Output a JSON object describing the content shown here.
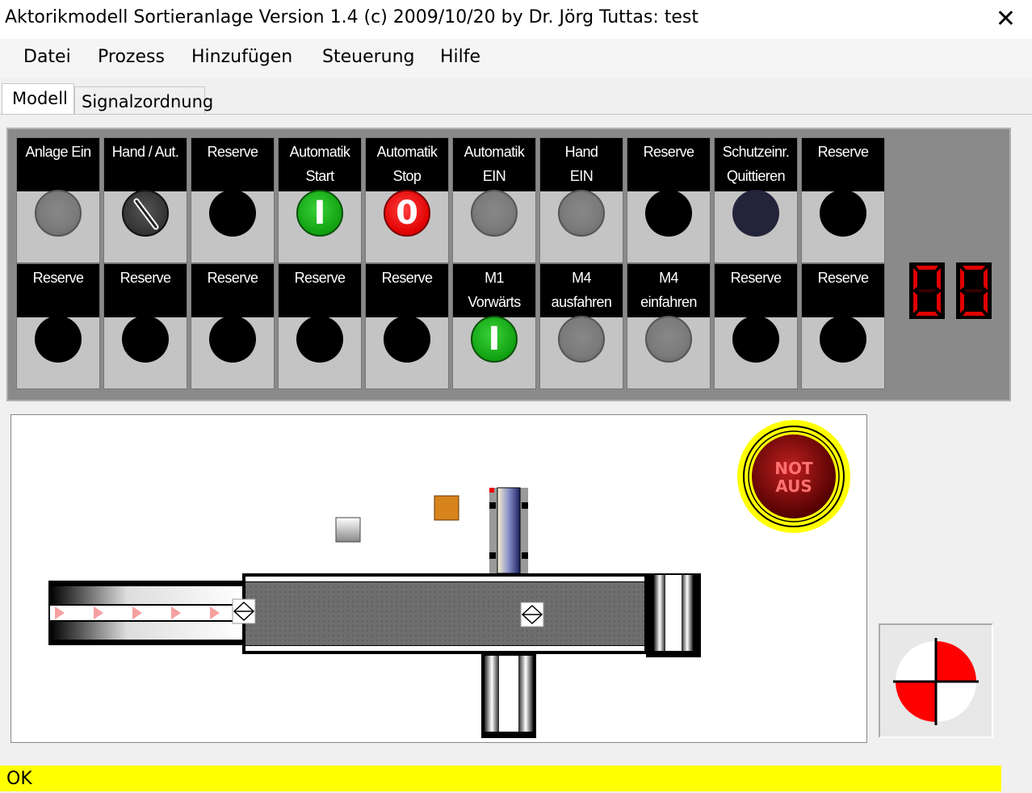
{
  "window": {
    "title": "Aktorikmodell Sortieranlage Version 1.4 (c) 2009/10/20 by Dr. Jörg Tuttas: test",
    "close_glyph": "✕"
  },
  "menu": [
    "Datei",
    "Prozess",
    "Hinzufügen",
    "Steuerung",
    "Hilfe"
  ],
  "tabs": [
    {
      "label": "Modell",
      "active": true
    },
    {
      "label": "Signalzordnung",
      "active": false
    }
  ],
  "panel": {
    "row1": [
      {
        "label": "Anlage Ein",
        "state": "gray",
        "glyph": ""
      },
      {
        "label": "Hand / Aut.",
        "state": "switch",
        "glyph": ""
      },
      {
        "label": "Reserve",
        "state": "black",
        "glyph": ""
      },
      {
        "label": "Automatik\nStart",
        "state": "green",
        "glyph": "I"
      },
      {
        "label": "Automatik\nStop",
        "state": "red",
        "glyph": "0"
      },
      {
        "label": "Automatik\nEIN",
        "state": "gray",
        "glyph": ""
      },
      {
        "label": "Hand\nEIN",
        "state": "gray",
        "glyph": ""
      },
      {
        "label": "Reserve",
        "state": "black",
        "glyph": ""
      },
      {
        "label": "Schutzeinr.\nQuittieren",
        "state": "navy",
        "glyph": ""
      },
      {
        "label": "Reserve",
        "state": "black",
        "glyph": ""
      }
    ],
    "row2": [
      {
        "label": "Reserve",
        "state": "black",
        "glyph": ""
      },
      {
        "label": "Reserve",
        "state": "black",
        "glyph": ""
      },
      {
        "label": "Reserve",
        "state": "black",
        "glyph": ""
      },
      {
        "label": "Reserve",
        "state": "black",
        "glyph": ""
      },
      {
        "label": "Reserve",
        "state": "black",
        "glyph": ""
      },
      {
        "label": "M1\nVorwärts",
        "state": "green",
        "glyph": "I"
      },
      {
        "label": "M4\nausfahren",
        "state": "gray",
        "glyph": ""
      },
      {
        "label": "M4\neinfahren",
        "state": "gray",
        "glyph": ""
      },
      {
        "label": "Reserve",
        "state": "black",
        "glyph": ""
      },
      {
        "label": "Reserve",
        "state": "black",
        "glyph": ""
      }
    ],
    "display_value": "00",
    "display_color": "#e00000"
  },
  "emergency_stop": {
    "line1": "NOT",
    "line2": "AUS"
  },
  "status": {
    "text": "OK",
    "color": "#ffff00"
  },
  "colors": {
    "panel_bg": "#8a8a8a",
    "status_bg": "#ffff00",
    "sensor_red": "#ff0000"
  }
}
